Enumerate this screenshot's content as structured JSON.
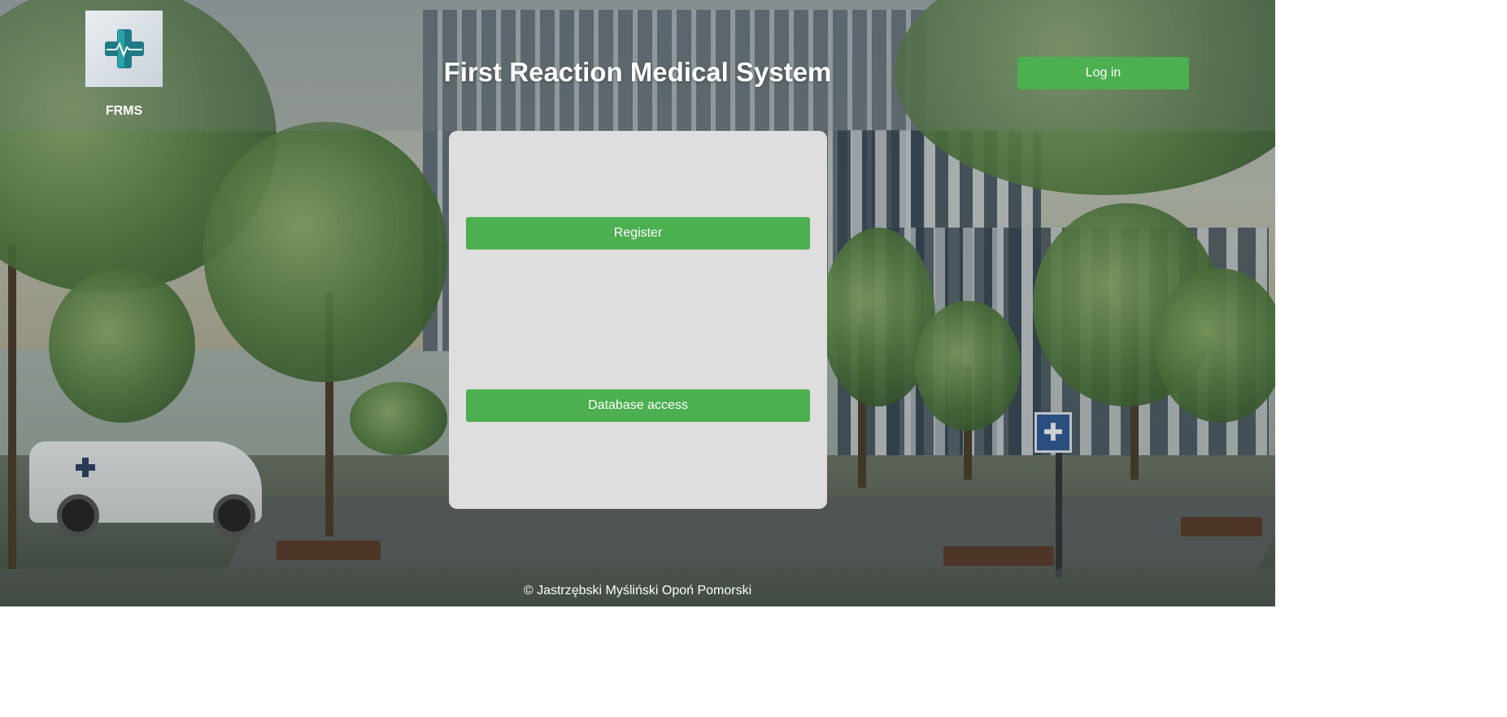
{
  "header": {
    "logo_label": "FRMS",
    "title": "First Reaction Medical System",
    "login_label": "Log in"
  },
  "main": {
    "register_label": "Register",
    "database_label": "Database access"
  },
  "footer": {
    "copyright": "© Jastrzębski Myśliński Opoń Pomorski"
  },
  "colors": {
    "accent": "#4caf50",
    "panel": "#dedede",
    "logo_cross": "#1f7a86"
  }
}
